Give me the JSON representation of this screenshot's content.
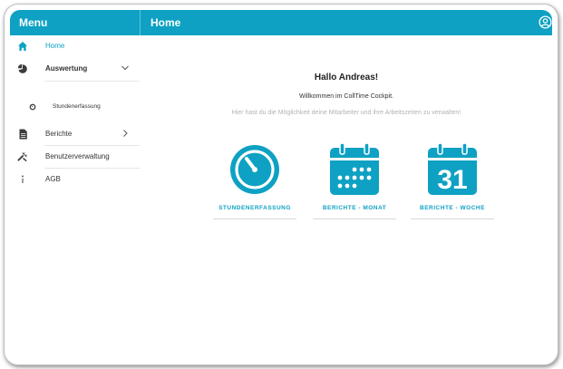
{
  "topbar": {
    "menu_title": "Menu",
    "page_title": "Home",
    "account_icon": "account-circle-icon"
  },
  "sidebar": {
    "items": [
      {
        "label": "Home",
        "icon": "home-icon",
        "active": true
      },
      {
        "label": "Auswertung",
        "icon": "pie-chart-icon",
        "expanded": true,
        "bold": true
      },
      {
        "label": "Stundenerfassung",
        "icon": "stopwatch-icon",
        "sub": true
      },
      {
        "label": "Berichte",
        "icon": "document-icon"
      },
      {
        "label": "Benutzerverwaltung",
        "icon": "tools-icon"
      },
      {
        "label": "AGB",
        "icon": "info-icon"
      }
    ]
  },
  "main": {
    "heading": "Hallo Andreas!",
    "welcome": "Willkommen im CollTime Cockpit.",
    "hint": "Hier hast du die Möglichkeit deine Mitarbeiter und ihre Arbeitszeiten zu verwalten!",
    "tiles": [
      {
        "label": "STUNDENERFASSUNG",
        "icon": "stopwatch-icon"
      },
      {
        "label": "BERICHTE - MONAT",
        "icon": "calendar-month-icon"
      },
      {
        "label": "BERICHTE - WOCHE",
        "icon": "calendar-week-icon",
        "day_number": "31"
      }
    ]
  },
  "colors": {
    "accent": "#0ea1c3",
    "icon_dark": "#3c3c3c"
  }
}
